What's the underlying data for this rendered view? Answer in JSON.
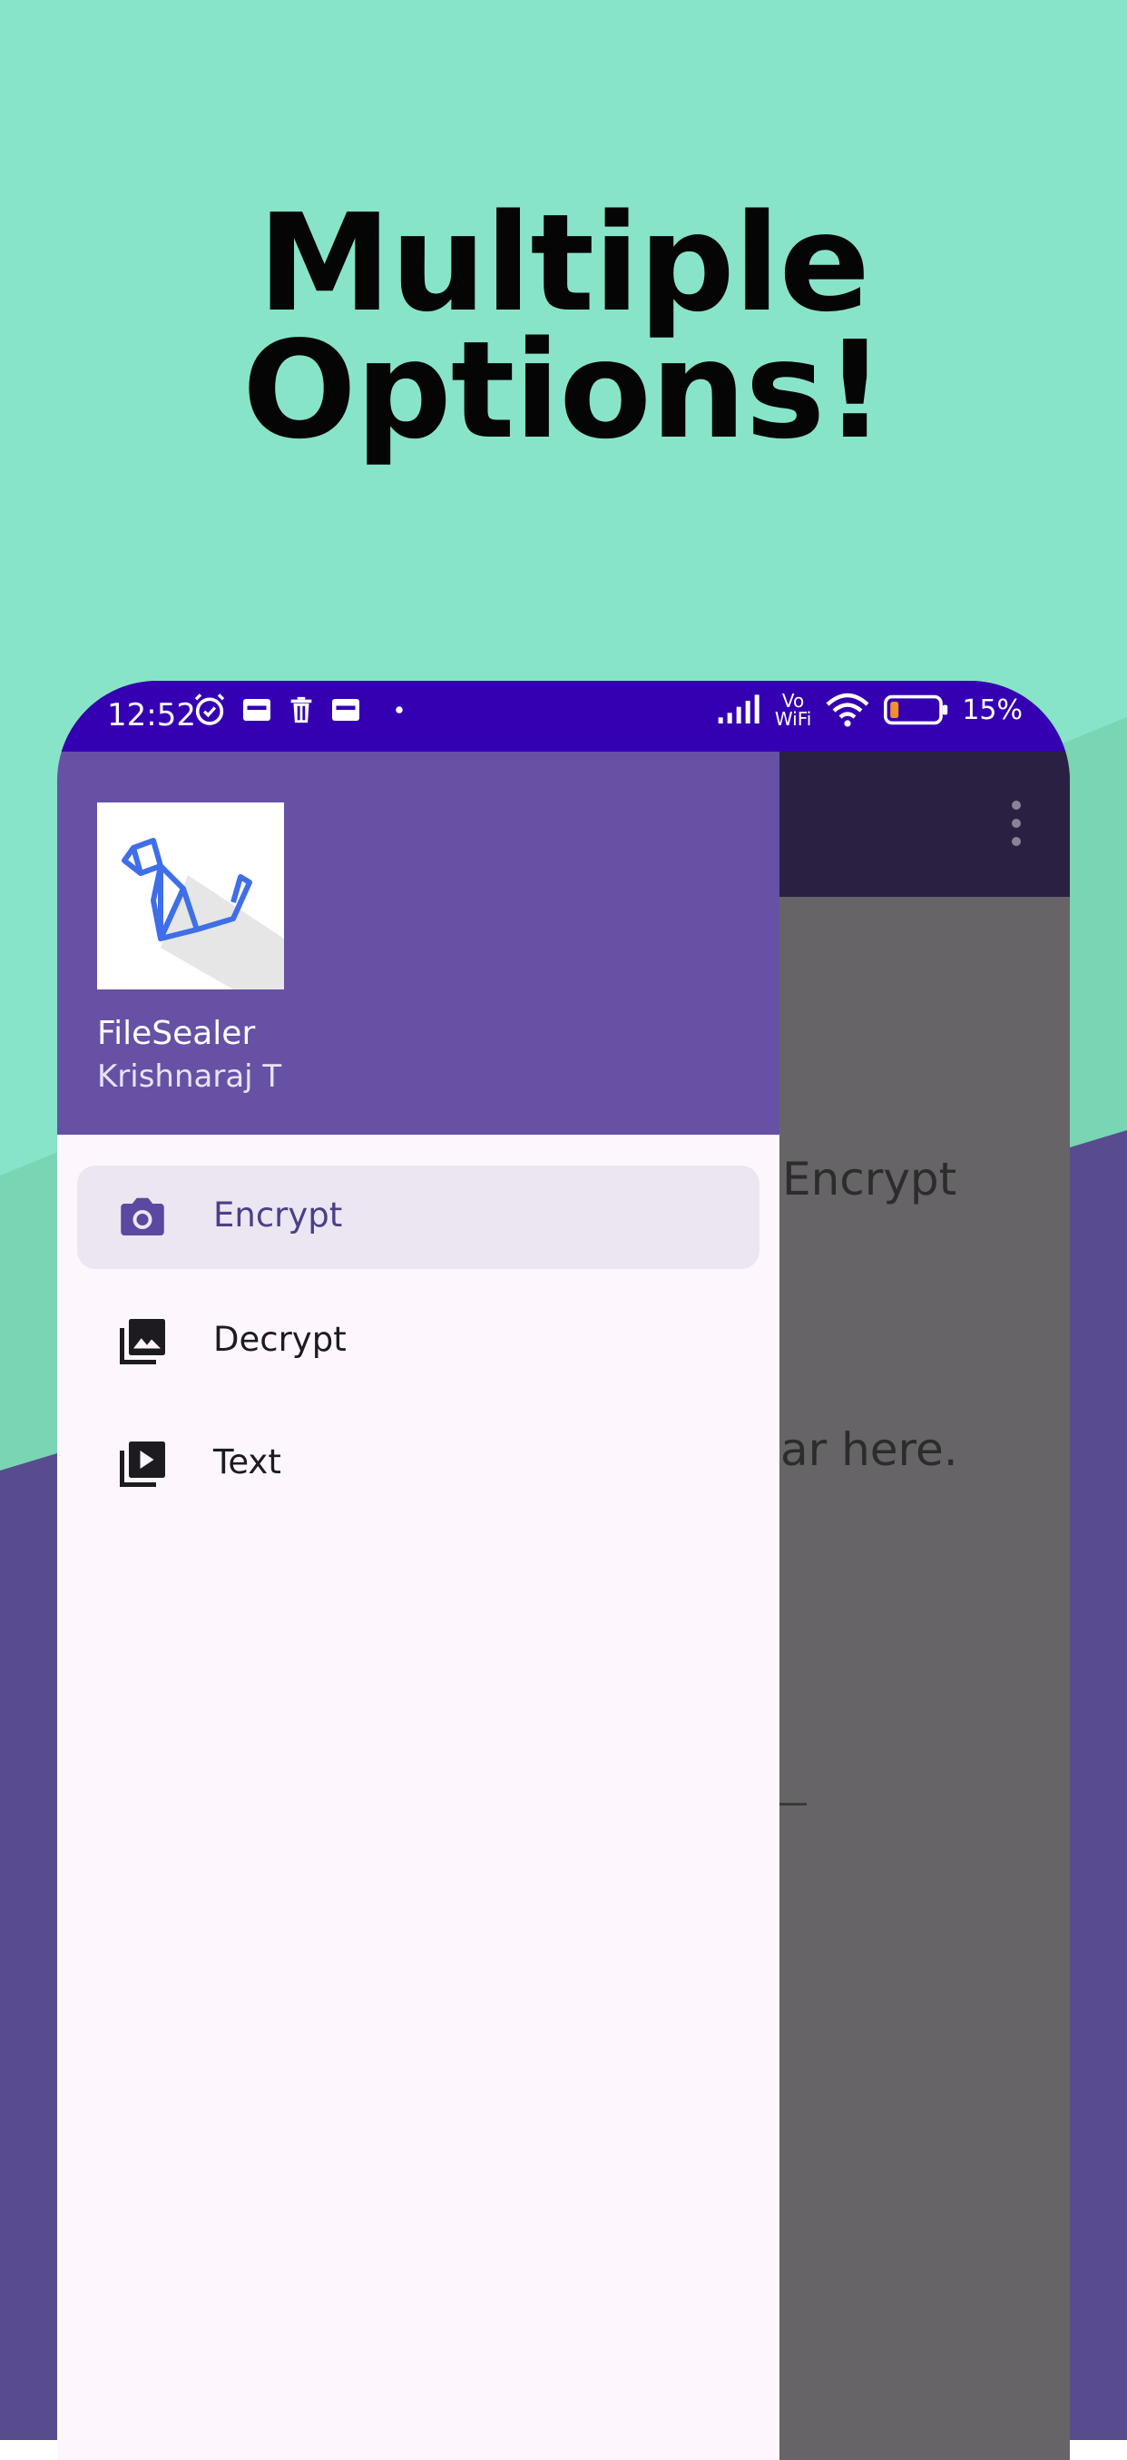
{
  "headline": {
    "line1": "Multiple",
    "line2": "Options!"
  },
  "colors": {
    "bg_mint": "#88e4c8",
    "bg_mint_dark": "#79d5b4",
    "bg_purple": "#584c8e",
    "status_bar": "#3500b2",
    "drawer_header": "#6751a5",
    "active_item_bg": "#ebe6f1"
  },
  "status_bar": {
    "time": "12:52",
    "battery": "15%",
    "left_icons": [
      "alarm-icon",
      "notification-icon",
      "trash-icon",
      "notification-icon",
      "dot-icon"
    ],
    "right_icons": [
      "signal-icon",
      "vowifi-icon",
      "wifi-icon",
      "battery-icon"
    ],
    "vowifi_top": "Vo",
    "vowifi_bottom": "WiFi"
  },
  "drawer": {
    "app_name": "FileSealer",
    "user_name": "Krishnaraj T",
    "logo_icon": "origami-dog-icon",
    "items": [
      {
        "label": "Encrypt",
        "icon": "camera-icon",
        "active": true
      },
      {
        "label": "Decrypt",
        "icon": "photo-library-icon",
        "active": false
      },
      {
        "label": "Text",
        "icon": "video-library-icon",
        "active": false
      }
    ]
  },
  "background_screen": {
    "text_1": "Encrypt",
    "text_2": "ar here."
  }
}
